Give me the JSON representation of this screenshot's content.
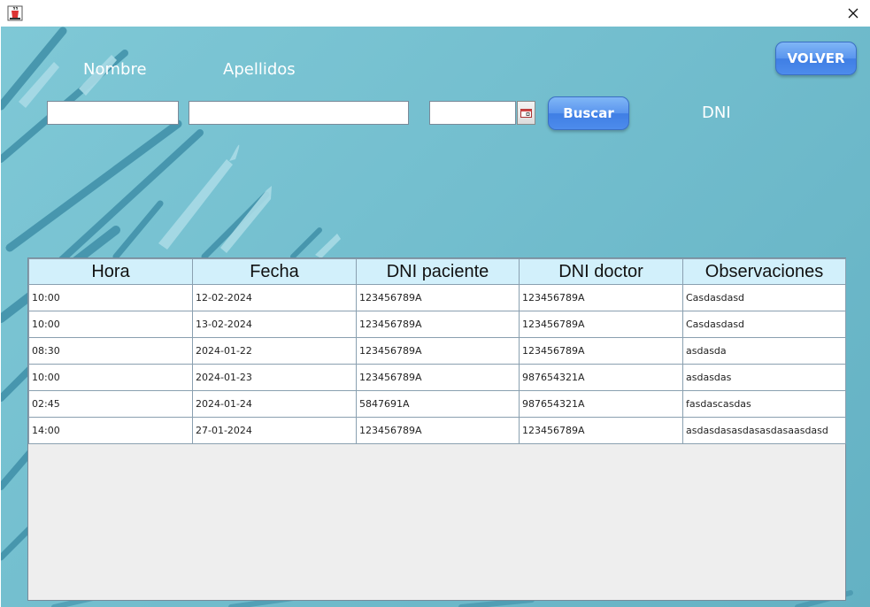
{
  "window": {
    "icons": {
      "app": "java-cup-icon",
      "close": "close-icon"
    }
  },
  "form": {
    "nombre_label": "Nombre",
    "apellidos_label": "Apellidos",
    "dni_label": "DNI",
    "nombre_value": "",
    "apellidos_value": "",
    "fecha_value": "",
    "date_picker_icon": "calendar-icon",
    "buscar_label": "Buscar",
    "volver_label": "VOLVER"
  },
  "table": {
    "columns": [
      "Hora",
      "Fecha",
      "DNI paciente",
      "DNI doctor",
      "Observaciones"
    ],
    "rows": [
      [
        "10:00",
        "12-02-2024",
        "123456789A",
        "123456789A",
        "Casdasdasd"
      ],
      [
        "10:00",
        "13-02-2024",
        "123456789A",
        "123456789A",
        "Casdasdasd"
      ],
      [
        "08:30",
        "2024-01-22",
        "123456789A",
        "123456789A",
        "asdasda"
      ],
      [
        "10:00",
        "2024-01-23",
        "123456789A",
        "987654321A",
        "asdasdas"
      ],
      [
        "02:45",
        "2024-01-24",
        "5847691A",
        "987654321A",
        "fasdascasdas"
      ],
      [
        "14:00",
        "27-01-2024",
        "123456789A",
        "123456789A",
        "asdasdasasdasasdasaasdasd"
      ]
    ]
  },
  "colors": {
    "background": "#74bfcf",
    "header_bg": "#d2f0fb",
    "button_blue": "#4d8cec"
  }
}
